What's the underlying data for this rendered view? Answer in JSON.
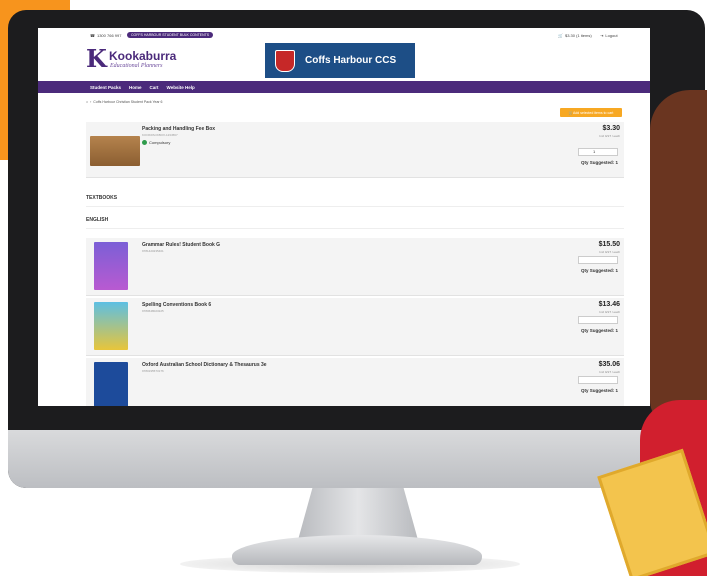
{
  "topbar": {
    "phone": "1300 766 997",
    "pill": "COFFS HARBOUR STUDENT BULK CONTENTS",
    "cart": "$3.30 (1 items)",
    "logout": "Logout"
  },
  "brand": {
    "name": "Kookaburra",
    "tagline": "Educational Planners",
    "school": "Coffs Harbour CCS"
  },
  "nav": [
    "Student Packs",
    "Home",
    "Cart",
    "Website Help"
  ],
  "breadcrumb": "Coffs Harbour Christian Student Pack Year 6",
  "add_button": "Add selected items to cart",
  "fee_item": {
    "name": "Packing and Handling Fee Box",
    "code": "KOOKPACKBOX-1234567",
    "status": "Compulsory",
    "price": "$3.30",
    "gst": "Incl GST / each",
    "qty": "1",
    "qty_suggested": "Qty Suggested: 1"
  },
  "sections": {
    "textbooks": "TEXTBOOKS",
    "english": "ENGLISH"
  },
  "books": [
    {
      "name": "Grammar Rules! Student Book G",
      "code": "9781420235401",
      "price": "$15.50",
      "gst": "Incl GST / each",
      "qty": "",
      "qty_suggested": "Qty Suggested: 1"
    },
    {
      "name": "Spelling Conventions Book 6",
      "code": "9780648023225",
      "price": "$13.46",
      "gst": "Incl GST / each",
      "qty": "",
      "qty_suggested": "Qty Suggested: 1"
    },
    {
      "name": "Oxford Australian School Dictionary & Thesaurus 3e",
      "code": "9780195573176",
      "price": "$35.06",
      "gst": "Incl GST / each",
      "qty": "",
      "qty_suggested": "Qty Suggested: 1"
    }
  ]
}
